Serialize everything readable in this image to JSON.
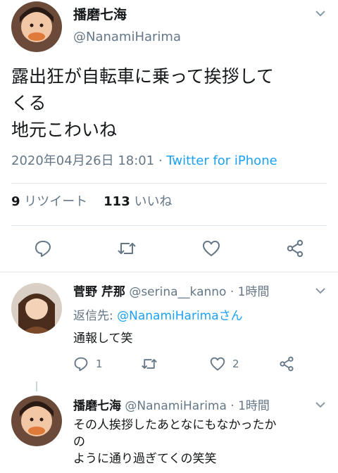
{
  "main_tweet": {
    "name": "播磨七海",
    "handle": "@NanamiHarima",
    "text": "露出狂が自転車に乗って挨拶して\nくる\n地元こわいね",
    "date": "2020年04月26日 18:01",
    "separator": " · ",
    "source": "Twitter for iPhone",
    "retweets_count": "9",
    "retweets_label": "リツイート",
    "likes_count": "113",
    "likes_label": "いいね"
  },
  "replies": [
    {
      "name": "菅野 芹那",
      "handle": "@serina__kanno",
      "time": " · 1時間",
      "reply_prefix": "返信先: ",
      "reply_to": "@NanamiHarimaさん",
      "text": "通報して笑",
      "reply_count": "1",
      "like_count": "2"
    },
    {
      "name": "播磨七海",
      "handle": "@NanamiHarima",
      "time": " · 1時間",
      "text": "その人挨拶したあとなにもなかったか\nの\nように通り過ぎてくの笑笑"
    }
  ],
  "colors": {
    "accent": "#1da1f2",
    "secondary_text": "#657786",
    "primary_text": "#14171a",
    "divider": "#e1e8ed"
  },
  "icons": [
    "chevron-down-icon",
    "reply-icon",
    "retweet-icon",
    "heart-icon",
    "share-icon"
  ]
}
